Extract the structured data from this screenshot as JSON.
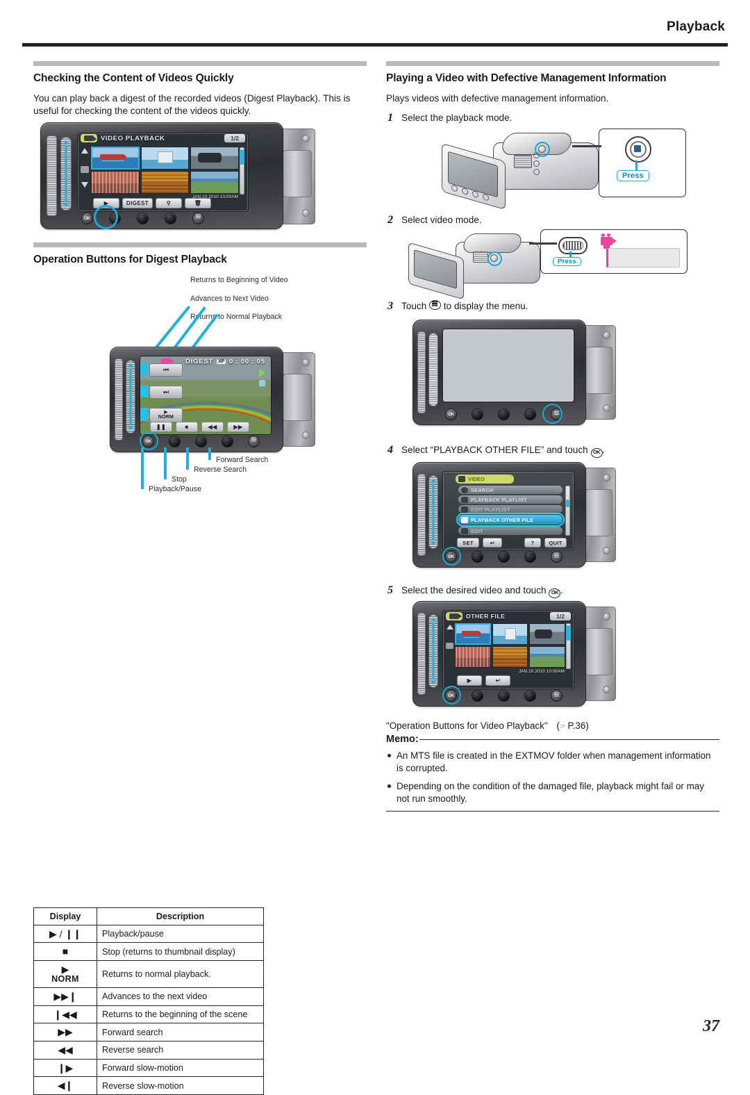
{
  "header": {
    "running_title": "Playback"
  },
  "page_number": "37",
  "left": {
    "section1": {
      "title": "Checking the Content of Videos Quickly",
      "paragraph": "You can play back a digest of the recorded videos (Digest Playback). This is useful for checking the content of the videos quickly.",
      "screen": {
        "mode_label": "VIDEO PLAYBACK",
        "page_indicator": "1/2",
        "date_stamp": "JAN.10 2010 10:00AM",
        "op_buttons": [
          "▶",
          "DIGEST",
          "⚲",
          "Ὕ1"
        ],
        "op_button_labels": {
          "play": "▶",
          "digest": "DIGEST",
          "search": "Q",
          "delete": "trash"
        },
        "hw_buttons": [
          "OK",
          "",
          "",
          "",
          "MENU"
        ]
      }
    },
    "section2": {
      "title": "Operation Buttons for Digest Playback",
      "callouts_top": [
        "Returns to Beginning of Video",
        "Advances to Next Video",
        "Returns to Normal Playback"
      ],
      "callouts_bottom": [
        "Forward Search",
        "Reverse Search",
        "Stop",
        "Playback/Pause"
      ],
      "screen": {
        "digest_label": "DIGEST",
        "quality_chip": "XP",
        "timecode": "0 : 00 : 05",
        "side_buttons": [
          "⏮",
          "⏭",
          "NORM"
        ],
        "bottom_buttons": [
          "‖",
          "■",
          "◀◀",
          "▶▶"
        ]
      }
    },
    "table": {
      "headers": [
        "Display",
        "Description"
      ],
      "rows": [
        {
          "icon": "▶ / ❙❙",
          "icon_sub": "",
          "desc": "Playback/pause"
        },
        {
          "icon": "■",
          "icon_sub": "",
          "desc": "Stop (returns to thumbnail display)"
        },
        {
          "icon": "▶",
          "icon_sub": "NORM",
          "desc": "Returns to normal playback."
        },
        {
          "icon": "▶▶❙",
          "icon_sub": "",
          "desc": "Advances to the next video"
        },
        {
          "icon": "❙◀◀",
          "icon_sub": "",
          "desc": "Returns to the beginning of the scene"
        },
        {
          "icon": "▶▶",
          "icon_sub": "",
          "desc": "Forward search"
        },
        {
          "icon": "◀◀",
          "icon_sub": "",
          "desc": "Reverse search"
        },
        {
          "icon": "❙▶",
          "icon_sub": "",
          "desc": "Forward slow-motion"
        },
        {
          "icon": "◀❙",
          "icon_sub": "",
          "desc": "Reverse slow-motion"
        }
      ]
    }
  },
  "right": {
    "section": {
      "title": "Playing a Video with Defective Management Information",
      "intro": "Plays videos with defective management information."
    },
    "steps": [
      {
        "num": "1",
        "text": "Select the playback mode.",
        "callout": "Press"
      },
      {
        "num": "2",
        "text": "Select video mode.",
        "callout": "Press"
      },
      {
        "num": "3",
        "text_before": "Touch ",
        "text_after": " to display the menu."
      },
      {
        "num": "4",
        "text_before": "Select “PLAYBACK OTHER FILE” and touch ",
        "text_after": "."
      },
      {
        "num": "5",
        "text_before": "Select the desired video and touch ",
        "text_after": "."
      }
    ],
    "menu_screen": {
      "title_row": "VIDEO",
      "items": [
        "SEARCH",
        "PLAYBACK PLAYLIST",
        "EDIT PLAYLIST",
        "PLAYBACK OTHER FILE",
        "EDIT"
      ],
      "selected_item": "PLAYBACK OTHER FILE",
      "bottom_buttons": [
        "SET",
        "↩",
        "?",
        "QUIT"
      ]
    },
    "other_file_screen": {
      "mode_label": "OTHER FILE",
      "page_indicator": "1/2",
      "date_stamp": "JAN.10.2010 10:00AM",
      "op_buttons": [
        "▶",
        "↩"
      ]
    },
    "reference": {
      "text": "\"Operation Buttons for Video Playback\"",
      "pointer": "☞",
      "page": "P.36"
    },
    "memo": {
      "label": "Memo:",
      "items": [
        "An MTS file is created in the EXTMOV folder when management information is corrupted.",
        "Depending on the condition of the damaged file, playback might fail or may not run smoothly."
      ]
    }
  },
  "colors": {
    "accent_cyan": "#1fb0e0",
    "rule_dark": "#231f20",
    "section_bar": "#b9b9b9",
    "menu_green": "#cdd96a",
    "press_blue": "#1189c0"
  }
}
